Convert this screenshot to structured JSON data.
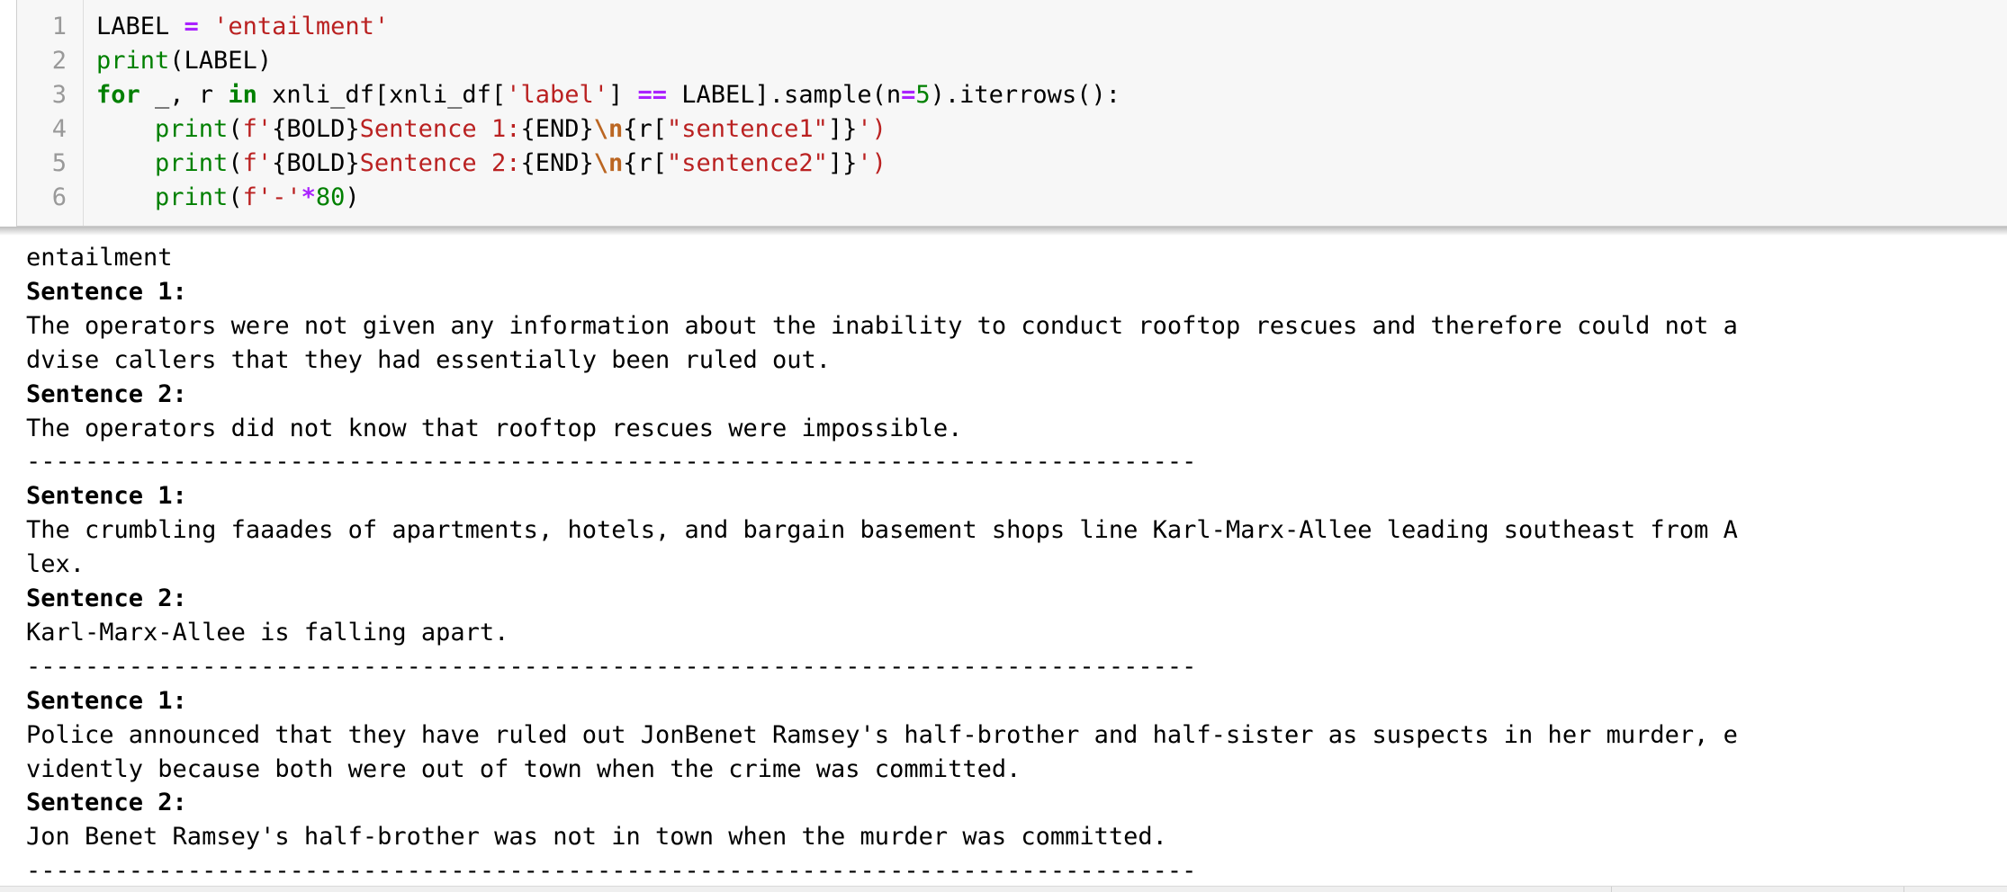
{
  "code_cell": {
    "line_numbers": [
      "1",
      "2",
      "3",
      "4",
      "5",
      "6"
    ],
    "lines": [
      [
        {
          "t": "LABEL ",
          "c": ""
        },
        {
          "t": "=",
          "c": "op"
        },
        {
          "t": " ",
          "c": ""
        },
        {
          "t": "'entailment'",
          "c": "str"
        }
      ],
      [
        {
          "t": "print",
          "c": "bi"
        },
        {
          "t": "(LABEL)",
          "c": ""
        }
      ],
      [
        {
          "t": "for",
          "c": "kw"
        },
        {
          "t": " _, r ",
          "c": ""
        },
        {
          "t": "in",
          "c": "kw"
        },
        {
          "t": " xnli_df[xnli_df[",
          "c": ""
        },
        {
          "t": "'label'",
          "c": "str"
        },
        {
          "t": "] ",
          "c": ""
        },
        {
          "t": "==",
          "c": "op"
        },
        {
          "t": " LABEL].sample(n",
          "c": ""
        },
        {
          "t": "=",
          "c": "op"
        },
        {
          "t": "5",
          "c": "num"
        },
        {
          "t": ").iterrows():",
          "c": ""
        }
      ],
      [
        {
          "t": "    ",
          "c": ""
        },
        {
          "t": "print",
          "c": "bi"
        },
        {
          "t": "(",
          "c": ""
        },
        {
          "t": "f'",
          "c": "str"
        },
        {
          "t": "{BOLD}",
          "c": ""
        },
        {
          "t": "Sentence 1:",
          "c": "str"
        },
        {
          "t": "{END}",
          "c": ""
        },
        {
          "t": "\\n",
          "c": "esc"
        },
        {
          "t": "{r[",
          "c": ""
        },
        {
          "t": "\"sentence1\"",
          "c": "str"
        },
        {
          "t": "]}",
          "c": ""
        },
        {
          "t": "')",
          "c": "str"
        }
      ],
      [
        {
          "t": "    ",
          "c": ""
        },
        {
          "t": "print",
          "c": "bi"
        },
        {
          "t": "(",
          "c": ""
        },
        {
          "t": "f'",
          "c": "str"
        },
        {
          "t": "{BOLD}",
          "c": ""
        },
        {
          "t": "Sentence 2:",
          "c": "str"
        },
        {
          "t": "{END}",
          "c": ""
        },
        {
          "t": "\\n",
          "c": "esc"
        },
        {
          "t": "{r[",
          "c": ""
        },
        {
          "t": "\"sentence2\"",
          "c": "str"
        },
        {
          "t": "]}",
          "c": ""
        },
        {
          "t": "')",
          "c": "str"
        }
      ],
      [
        {
          "t": "    ",
          "c": ""
        },
        {
          "t": "print",
          "c": "bi"
        },
        {
          "t": "(",
          "c": ""
        },
        {
          "t": "f'-'",
          "c": "str"
        },
        {
          "t": "*",
          "c": "op"
        },
        {
          "t": "80",
          "c": "num"
        },
        {
          "t": ")",
          "c": ""
        }
      ]
    ]
  },
  "output": {
    "lines": [
      {
        "text": "entailment",
        "bold": false
      },
      {
        "text": "Sentence 1:",
        "bold": true
      },
      {
        "text": "The operators were not given any information about the inability to conduct rooftop rescues and therefore could not a",
        "bold": false
      },
      {
        "text": "dvise callers that they had essentially been ruled out.",
        "bold": false
      },
      {
        "text": "Sentence 2:",
        "bold": true
      },
      {
        "text": "The operators did not know that rooftop rescues were impossible.",
        "bold": false
      },
      {
        "text": "--------------------------------------------------------------------------------",
        "bold": false
      },
      {
        "text": "Sentence 1:",
        "bold": true
      },
      {
        "text": "The crumbling faaades of apartments, hotels, and bargain basement shops line Karl-Marx-Allee leading southeast from A",
        "bold": false
      },
      {
        "text": "lex.",
        "bold": false
      },
      {
        "text": "Sentence 2:",
        "bold": true
      },
      {
        "text": "Karl-Marx-Allee is falling apart.",
        "bold": false
      },
      {
        "text": "--------------------------------------------------------------------------------",
        "bold": false
      },
      {
        "text": "Sentence 1:",
        "bold": true
      },
      {
        "text": "Police announced that they have ruled out JonBenet Ramsey's half-brother and half-sister as suspects in her murder, e",
        "bold": false
      },
      {
        "text": "vidently because both were out of town when the crime was committed.",
        "bold": false
      },
      {
        "text": "Sentence 2:",
        "bold": true
      },
      {
        "text": "Jon Benet Ramsey's half-brother was not in town when the murder was committed.",
        "bold": false
      },
      {
        "text": "--------------------------------------------------------------------------------",
        "bold": false
      }
    ]
  },
  "colors": {
    "keyword": "#008000",
    "operator": "#aa22ff",
    "string": "#ba2121",
    "escape": "#bb6622",
    "cell_background": "#f7f7f7",
    "line_number": "#999999"
  }
}
